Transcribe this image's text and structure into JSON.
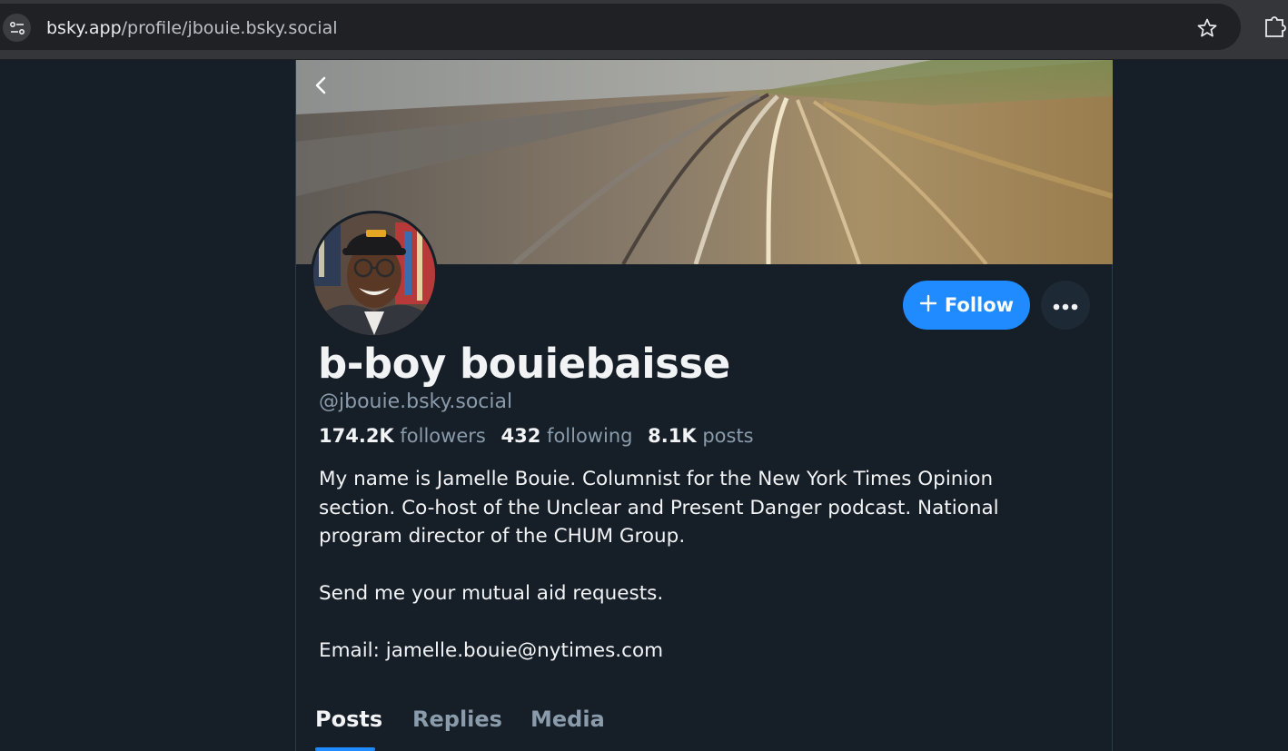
{
  "browser": {
    "url_domain": "bsky.app",
    "url_path": "/profile/jbouie.bsky.social"
  },
  "profile": {
    "display_name": "b-boy bouiebaisse",
    "handle": "@jbouie.bsky.social",
    "followers_count": "174.2K",
    "followers_label": "followers",
    "following_count": "432",
    "following_label": "following",
    "posts_count": "8.1K",
    "posts_label": "posts",
    "bio": {
      "line1": "My name is Jamelle Bouie. Columnist for the New York Times Opinion",
      "line2": "section. Co-host of the Unclear and Present Danger podcast. National",
      "line3": "program director of the CHUM Group.",
      "line4": "Send me your mutual aid requests.",
      "line5": "Email: jamelle.bouie@nytimes.com"
    }
  },
  "actions": {
    "follow_label": "Follow"
  },
  "tabs": [
    {
      "label": "Posts",
      "active": true
    },
    {
      "label": "Replies",
      "active": false
    },
    {
      "label": "Media",
      "active": false
    }
  ],
  "colors": {
    "accent": "#208bfe",
    "background": "#161e27",
    "text": "#f1f3f5",
    "muted": "#8a9bab"
  },
  "icons": {
    "site_info": "tune-icon",
    "bookmark": "star-icon",
    "extensions": "puzzle-icon",
    "back": "chevron-left-icon",
    "follow": "plus-icon",
    "more": "ellipsis-icon"
  }
}
